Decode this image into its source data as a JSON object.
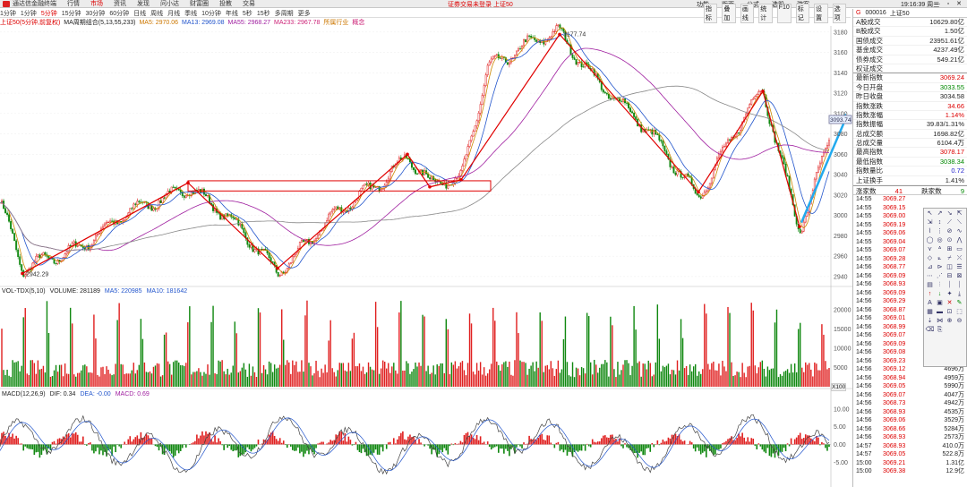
{
  "menubar": {
    "items": [
      "通达信金融终端",
      "行情",
      "市场",
      "资讯",
      "发现",
      "问小达",
      "财富圈",
      "投教",
      "交易"
    ],
    "active": "市场",
    "center_note": "证券交易未登录 上证50",
    "right_items": [
      "功能",
      "版面",
      "公式",
      "选股",
      "游客"
    ],
    "clock": "19:16:39 周三"
  },
  "toolbar": {
    "periods": [
      "1分钟",
      "1分钟",
      "5分钟",
      "15分钟",
      "30分钟",
      "60分钟",
      "日线",
      "周线",
      "月线",
      "季线",
      "10分钟",
      "年线",
      "5秒",
      "15秒",
      "多周期",
      "更多"
    ],
    "active_period": "5分钟",
    "right_tools": [
      "指标",
      "叠加",
      "画线",
      "统计",
      "F10",
      "标记",
      "设置",
      "选项"
    ]
  },
  "legend": {
    "index_name": "上证50(5分钟,前复权)",
    "ma_label": "MA周期组合(5,13,55,233)",
    "ma5": "MA5: 2970.06",
    "ma13": "MA13: 2969.08",
    "ma55": "MA55: 2968.27",
    "ma233": "MA233: 2967.78",
    "extra1": "所属行业",
    "extra2": "概念"
  },
  "volume_legend": {
    "label": "VOL-TDX(5,10)",
    "vol": "VOLUME: 281189",
    "ma5": "MA5: 220985",
    "ma10": "MA10: 181642",
    "unit": "X100"
  },
  "macd_legend": {
    "label": "MACD(12,26,9)",
    "dif": "DIF: 0.34",
    "dea": "DEA: -0.00",
    "macd": "MACD: 0.69"
  },
  "price_axis": [
    "3180",
    "3160",
    "3140",
    "3120",
    "3100",
    "3080",
    "3060",
    "3040",
    "3020",
    "3000",
    "2980",
    "2960",
    "2940"
  ],
  "volume_axis": [
    "20000",
    "15000",
    "10000",
    "5000"
  ],
  "macd_axis": [
    "10.00",
    "5.00",
    "0.00",
    "-5.00"
  ],
  "annotations": {
    "high": "3177.74",
    "low": "2942.29",
    "cursor_price": "3093.74"
  },
  "colors": {
    "up": "#e02020",
    "down": "#108810",
    "trend_line": "#e00000",
    "blue_arrow": "#22aaee",
    "green_arrow": "#88cc22"
  },
  "quote_panel": {
    "code": "000016",
    "name": "上证50",
    "g_label": "G",
    "rows": [
      {
        "k": "A股成交",
        "v": "10629.80亿",
        "c": ""
      },
      {
        "k": "B股成交",
        "v": "1.50亿",
        "c": ""
      },
      {
        "k": "国债成交",
        "v": "23951.61亿",
        "c": ""
      },
      {
        "k": "基金成交",
        "v": "4237.49亿",
        "c": ""
      },
      {
        "k": "债券成交",
        "v": "549.21亿",
        "c": ""
      },
      {
        "k": "权证成交",
        "v": "",
        "c": ""
      },
      {
        "k": "最新指数",
        "v": "3069.24",
        "c": "red"
      },
      {
        "k": "今日开盘",
        "v": "3033.55",
        "c": "green"
      },
      {
        "k": "昨日收盘",
        "v": "3034.58",
        "c": ""
      },
      {
        "k": "指数涨跌",
        "v": "34.66",
        "c": "red"
      },
      {
        "k": "指数涨幅",
        "v": "1.14%",
        "c": "red"
      },
      {
        "k": "指数振幅",
        "v": "39.83/1.31%",
        "c": ""
      },
      {
        "k": "总成交额",
        "v": "1698.82亿",
        "c": ""
      },
      {
        "k": "总成交量",
        "v": "6104.4万",
        "c": ""
      },
      {
        "k": "最高指数",
        "v": "3078.17",
        "c": "red"
      },
      {
        "k": "最低指数",
        "v": "3038.34",
        "c": "green"
      },
      {
        "k": "指数量比",
        "v": "0.72",
        "c": "blue"
      },
      {
        "k": "上证换手",
        "v": "1.41%",
        "c": ""
      }
    ],
    "rise_label": "涨家数",
    "rise_count": "41",
    "fall_label": "跌家数",
    "fall_count": "9"
  },
  "ticks": [
    {
      "t": "14:55",
      "p": "3069.27",
      "v": ""
    },
    {
      "t": "14:55",
      "p": "3069.15",
      "v": ""
    },
    {
      "t": "14:55",
      "p": "3069.00",
      "v": ""
    },
    {
      "t": "14:55",
      "p": "3069.19",
      "v": ""
    },
    {
      "t": "14:55",
      "p": "3069.06",
      "v": ""
    },
    {
      "t": "14:55",
      "p": "3069.04",
      "v": ""
    },
    {
      "t": "14:55",
      "p": "3069.07",
      "v": ""
    },
    {
      "t": "14:55",
      "p": "3069.28",
      "v": ""
    },
    {
      "t": "14:56",
      "p": "3068.77",
      "v": ""
    },
    {
      "t": "14:56",
      "p": "3069.09",
      "v": ""
    },
    {
      "t": "14:56",
      "p": "3068.93",
      "v": ""
    },
    {
      "t": "14:56",
      "p": "3069.09",
      "v": ""
    },
    {
      "t": "14:56",
      "p": "3069.29",
      "v": ""
    },
    {
      "t": "14:56",
      "p": "3068.87",
      "v": ""
    },
    {
      "t": "14:56",
      "p": "3069.01",
      "v": ""
    },
    {
      "t": "14:56",
      "p": "3068.99",
      "v": ""
    },
    {
      "t": "14:56",
      "p": "3069.07",
      "v": ""
    },
    {
      "t": "14:56",
      "p": "3069.09",
      "v": ""
    },
    {
      "t": "14:56",
      "p": "3069.08",
      "v": ""
    },
    {
      "t": "14:56",
      "p": "3069.23",
      "v": "5873万"
    },
    {
      "t": "14:56",
      "p": "3069.12",
      "v": "4696万"
    },
    {
      "t": "14:56",
      "p": "3068.94",
      "v": "4959万"
    },
    {
      "t": "14:56",
      "p": "3069.05",
      "v": "5990万"
    },
    {
      "t": "14:56",
      "p": "3069.07",
      "v": "4047万"
    },
    {
      "t": "14:56",
      "p": "3068.73",
      "v": "4942万"
    },
    {
      "t": "14:56",
      "p": "3068.93",
      "v": "4535万"
    },
    {
      "t": "14:56",
      "p": "3069.06",
      "v": "3529万"
    },
    {
      "t": "14:56",
      "p": "3068.66",
      "v": "5284万"
    },
    {
      "t": "14:56",
      "p": "3068.93",
      "v": "2573万"
    },
    {
      "t": "14:57",
      "p": "3068.93",
      "v": "410.0万"
    },
    {
      "t": "14:57",
      "p": "3069.05",
      "v": "522.8万"
    },
    {
      "t": "15:00",
      "p": "3069.21",
      "v": "1.31亿"
    },
    {
      "t": "15:00",
      "p": "3069.38",
      "v": "12.9亿"
    }
  ],
  "draw_tools": [
    "↖",
    "↗",
    "↘",
    "⇱",
    "⇲",
    "↕",
    "⟋",
    "⟍",
    "⌇",
    "⋮",
    "⊘",
    "∿",
    "◯",
    "◎",
    "⊙",
    "⋀",
    "⋎",
    "ᐞ",
    "⊞",
    "▭",
    "◇",
    "⟀",
    "⌿",
    "⤫",
    "⊿",
    "⊳",
    "◫",
    "☰",
    "⋯",
    "⋰",
    "⊟",
    "⊠",
    "▤",
    "⫶",
    "⏐",
    "⏐",
    "↑",
    "↓",
    "✦",
    "⤓",
    "A",
    "▣",
    "✕",
    "✎",
    "▦",
    "▬",
    "⊡",
    "⬚",
    "⇣",
    "⋈",
    "⊕",
    "⊖",
    "⌫",
    "⎘"
  ]
}
